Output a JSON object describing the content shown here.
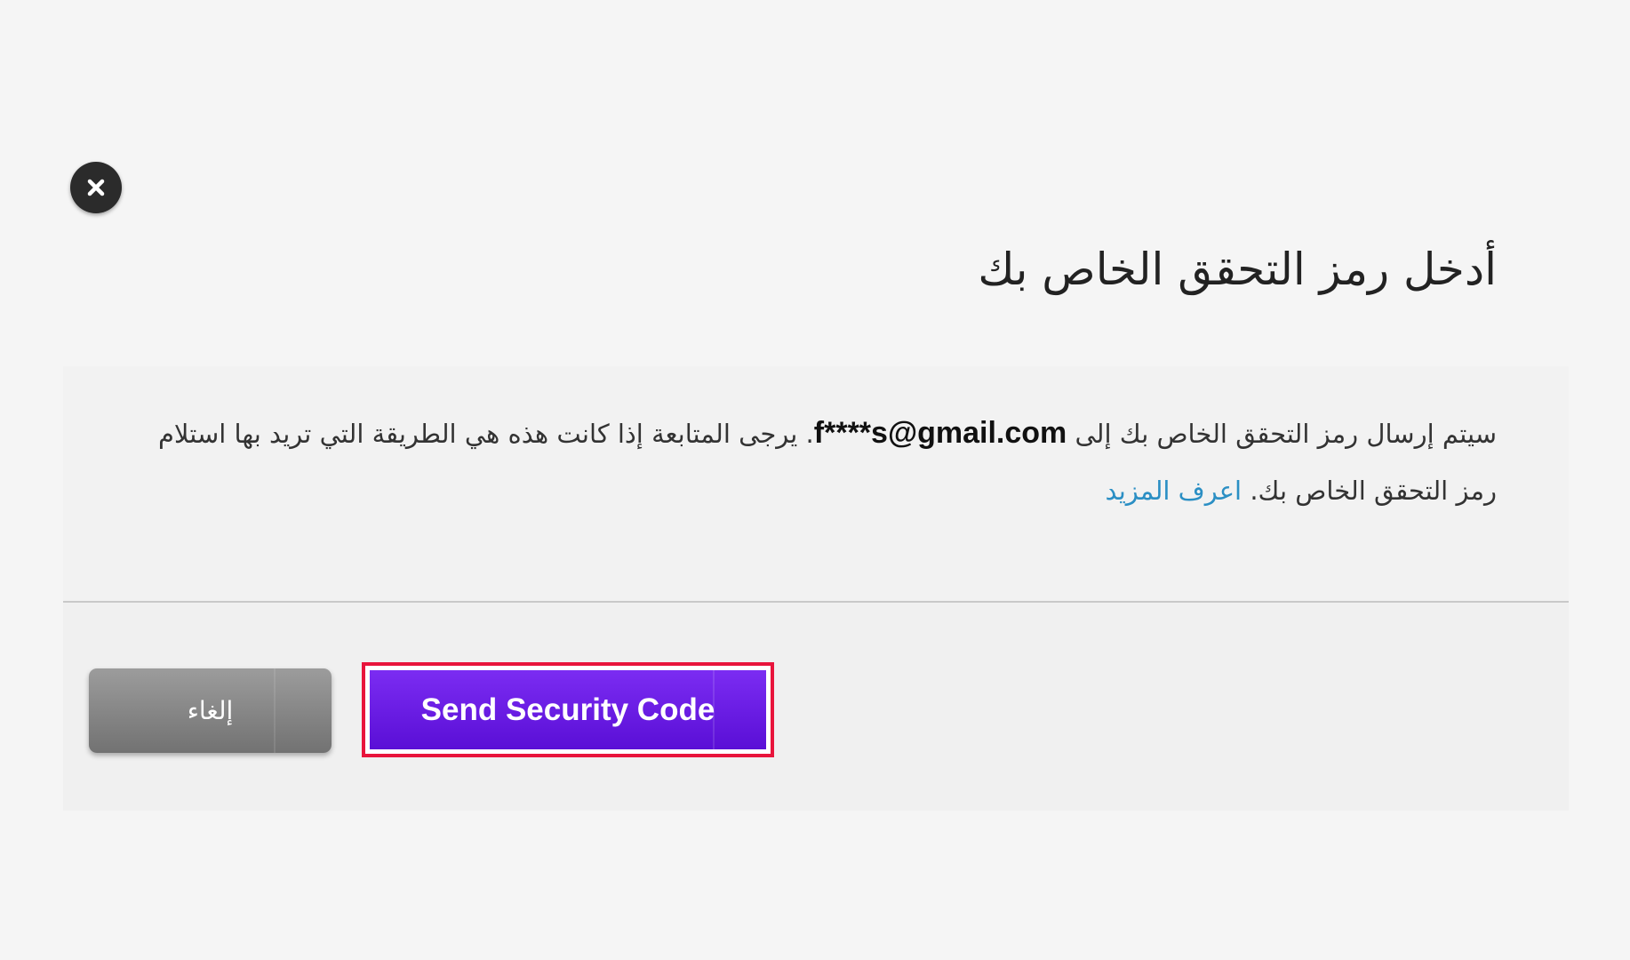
{
  "dialog": {
    "close_icon": "close-icon",
    "title": "أدخل رمز التحقق الخاص بك",
    "message": {
      "part1": "سيتم إرسال رمز التحقق الخاص بك إلى",
      "email": "f****s@gmail.com",
      "part2": ". يرجى المتابعة إذا كانت هذه هي الطريقة التي تريد بها استلام رمز التحقق الخاص بك.",
      "learn_more": "اعرف المزيد"
    },
    "buttons": {
      "cancel_label": "إلغاء",
      "send_label": "Send Security Code"
    },
    "colors": {
      "primary": "#6a1de6",
      "highlight": "#e8143c",
      "link": "#2b8fc4",
      "cancel": "#8a8a8a"
    }
  }
}
